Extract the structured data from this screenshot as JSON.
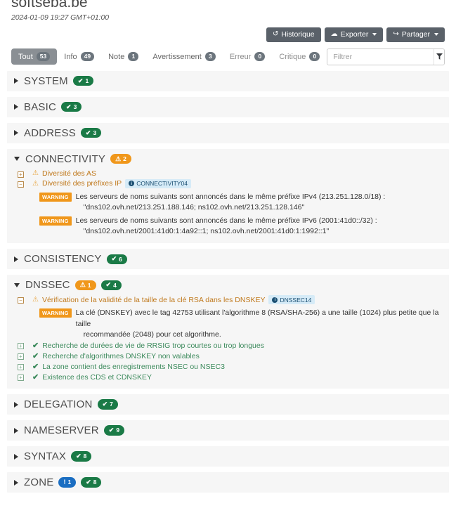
{
  "header": {
    "domain": "softseba.be",
    "timestamp": "2024-01-09 19:27 GMT+01:00"
  },
  "actions": [
    {
      "label": "Historique",
      "icon": "history-icon",
      "glyph": "↺",
      "caret": false
    },
    {
      "label": "Exporter",
      "icon": "cloud-download-icon",
      "glyph": "☁",
      "caret": true
    },
    {
      "label": "Partager",
      "icon": "share-icon",
      "glyph": "↪",
      "caret": true
    }
  ],
  "tabs": [
    {
      "label": "Tout",
      "count": "53",
      "active": true
    },
    {
      "label": "Info",
      "count": "49",
      "active": false
    },
    {
      "label": "Note",
      "count": "1",
      "active": false
    },
    {
      "label": "Avertissement",
      "count": "3",
      "active": false
    },
    {
      "label": "Erreur",
      "count": "0",
      "active": false
    },
    {
      "label": "Critique",
      "count": "0",
      "active": false
    }
  ],
  "filter": {
    "placeholder": "Filtrer",
    "value": "",
    "button_icon": "filter-icon"
  },
  "sections": [
    {
      "name": "SYSTEM",
      "expanded": false,
      "badges": [
        {
          "type": "ok",
          "sym": "✔",
          "count": "1"
        }
      ],
      "rows": []
    },
    {
      "name": "BASIC",
      "expanded": false,
      "badges": [
        {
          "type": "ok",
          "sym": "✔",
          "count": "3"
        }
      ],
      "rows": []
    },
    {
      "name": "ADDRESS",
      "expanded": false,
      "badges": [
        {
          "type": "ok",
          "sym": "✔",
          "count": "3"
        }
      ],
      "rows": []
    },
    {
      "name": "CONNECTIVITY",
      "expanded": true,
      "badges": [
        {
          "type": "warn",
          "sym": "⚠",
          "count": "2"
        }
      ],
      "rows": [
        {
          "toggle": "+",
          "state": "warn",
          "icon": "warning-triangle-icon",
          "label": "Diversité des AS",
          "tag": null,
          "messages": []
        },
        {
          "toggle": "−",
          "state": "warn",
          "icon": "warning-triangle-icon",
          "label": "Diversité des préfixes IP",
          "tag": "CONNECTIVITY04",
          "messages": [
            {
              "level": "WARNING",
              "line1": "Les serveurs de noms suivants sont annoncés dans le même préfixe IPv4 (213.251.128.0/18) :",
              "line2": "\"dns102.ovh.net/213.251.188.146; ns102.ovh.net/213.251.128.146\""
            },
            {
              "level": "WARNING",
              "line1": "Les serveurs de noms suivants sont annoncés dans le même préfixe IPv6 (2001:41d0::/32) :",
              "line2": "\"dns102.ovh.net/2001:41d0:1:4a92::1; ns102.ovh.net/2001:41d0:1:1992::1\""
            }
          ]
        }
      ]
    },
    {
      "name": "CONSISTENCY",
      "expanded": false,
      "badges": [
        {
          "type": "ok",
          "sym": "✔",
          "count": "6"
        }
      ],
      "rows": []
    },
    {
      "name": "DNSSEC",
      "expanded": true,
      "badges": [
        {
          "type": "warn",
          "sym": "⚠",
          "count": "1"
        },
        {
          "type": "ok",
          "sym": "✔",
          "count": "4"
        }
      ],
      "rows": [
        {
          "toggle": "−",
          "state": "warn",
          "icon": "warning-triangle-icon",
          "label": "Vérification de la validité de la taille de la clé RSA dans les DNSKEY",
          "tag": "DNSSEC14",
          "messages": [
            {
              "level": "WARNING",
              "line1": "La clé (DNSKEY) avec le tag 42753 utilisant l'algorithme 8 (RSA/SHA-256) a une taille (1024) plus petite que la taille",
              "line2": "recommandée (2048) pour cet algorithme."
            }
          ]
        },
        {
          "toggle": "+",
          "state": "ok",
          "icon": "check-icon",
          "label": "Recherche de durées de vie de RRSIG trop courtes ou trop longues",
          "tag": null,
          "messages": []
        },
        {
          "toggle": "+",
          "state": "ok",
          "icon": "check-icon",
          "label": "Recherche d'algorithmes DNSKEY non valables",
          "tag": null,
          "messages": []
        },
        {
          "toggle": "+",
          "state": "ok",
          "icon": "check-icon",
          "label": "La zone contient des enregistrements NSEC ou NSEC3",
          "tag": null,
          "messages": []
        },
        {
          "toggle": "+",
          "state": "ok",
          "icon": "check-icon",
          "label": "Existence des CDS et CDNSKEY",
          "tag": null,
          "messages": []
        }
      ]
    },
    {
      "name": "DELEGATION",
      "expanded": false,
      "badges": [
        {
          "type": "ok",
          "sym": "✔",
          "count": "7"
        }
      ],
      "rows": []
    },
    {
      "name": "NAMESERVER",
      "expanded": false,
      "badges": [
        {
          "type": "ok",
          "sym": "✔",
          "count": "9"
        }
      ],
      "rows": []
    },
    {
      "name": "SYNTAX",
      "expanded": false,
      "badges": [
        {
          "type": "ok",
          "sym": "✔",
          "count": "8"
        }
      ],
      "rows": []
    },
    {
      "name": "ZONE",
      "expanded": false,
      "badges": [
        {
          "type": "notice",
          "sym": "!",
          "count": "1"
        },
        {
          "type": "ok",
          "sym": "✔",
          "count": "8"
        }
      ],
      "rows": []
    }
  ]
}
